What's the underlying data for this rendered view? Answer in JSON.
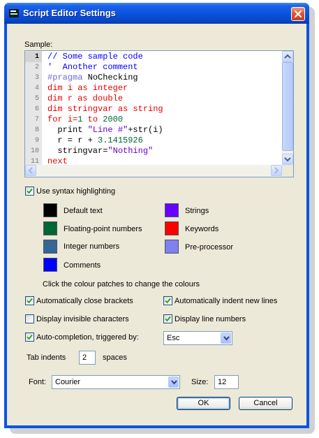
{
  "window": {
    "title": "Script Editor Settings"
  },
  "sample": {
    "label": "Sample:",
    "lines": [
      {
        "num": "1",
        "tokens": [
          {
            "t": "// Some sample code",
            "c": "comment"
          }
        ]
      },
      {
        "num": "2",
        "tokens": [
          {
            "t": "'  Another comment",
            "c": "comment"
          }
        ]
      },
      {
        "num": "3",
        "tokens": [
          {
            "t": "#pragma",
            "c": "pre"
          },
          {
            "t": " NoChecking",
            "c": "default"
          }
        ]
      },
      {
        "num": "4",
        "tokens": [
          {
            "t": "dim i as integer",
            "c": "keyword"
          }
        ]
      },
      {
        "num": "5",
        "tokens": [
          {
            "t": "dim r as double",
            "c": "keyword"
          }
        ]
      },
      {
        "num": "6",
        "tokens": [
          {
            "t": "dim stringvar as string",
            "c": "keyword"
          }
        ]
      },
      {
        "num": "7",
        "tokens": [
          {
            "t": "for i=",
            "c": "keyword"
          },
          {
            "t": "1",
            "c": "number"
          },
          {
            "t": " to ",
            "c": "keyword"
          },
          {
            "t": "2000",
            "c": "number"
          }
        ]
      },
      {
        "num": "8",
        "tokens": [
          {
            "t": "  print ",
            "c": "default"
          },
          {
            "t": "\"Line #\"",
            "c": "string"
          },
          {
            "t": "+str(i)",
            "c": "default"
          }
        ]
      },
      {
        "num": "9",
        "tokens": [
          {
            "t": "  r = r + ",
            "c": "default"
          },
          {
            "t": "3.1415926",
            "c": "number"
          }
        ]
      },
      {
        "num": "10",
        "tokens": [
          {
            "t": "  stringvar=",
            "c": "default"
          },
          {
            "t": "\"Nothing\"",
            "c": "string"
          }
        ]
      },
      {
        "num": "11",
        "tokens": [
          {
            "t": "next",
            "c": "keyword"
          }
        ]
      }
    ]
  },
  "syntax": {
    "use_label": "Use syntax highlighting",
    "use_checked": true,
    "colors": [
      {
        "label": "Default text",
        "color": "#000000"
      },
      {
        "label": "Floating-point numbers",
        "color": "#006633"
      },
      {
        "label": "Integer numbers",
        "color": "#336699"
      },
      {
        "label": "Comments",
        "color": "#0000ff"
      },
      {
        "label": "Strings",
        "color": "#6600ff"
      },
      {
        "label": "Keywords",
        "color": "#ff0000"
      },
      {
        "label": "Pre-processor",
        "color": "#8080f0"
      }
    ],
    "hint": "Click the colour patches to change the colours"
  },
  "options": {
    "close_brackets": {
      "label": "Automatically close brackets",
      "checked": true
    },
    "indent_new_lines": {
      "label": "Automatically indent new lines",
      "checked": true
    },
    "invisible_chars": {
      "label": "Display invisible characters",
      "checked": false
    },
    "line_numbers": {
      "label": "Display line numbers",
      "checked": true
    },
    "autocomplete": {
      "label": "Auto-completion, triggered by:",
      "checked": true,
      "trigger": "Esc"
    },
    "tab_indents": {
      "label": "Tab indents",
      "value": "2",
      "suffix": "spaces"
    }
  },
  "font": {
    "label": "Font:",
    "value": "Courier",
    "size_label": "Size:",
    "size_value": "12"
  },
  "buttons": {
    "ok": "OK",
    "cancel": "Cancel"
  },
  "colors": {
    "title_bar": "#0a54e0",
    "dialog_bg": "#ece9d8",
    "close_button": "#e0512e"
  }
}
